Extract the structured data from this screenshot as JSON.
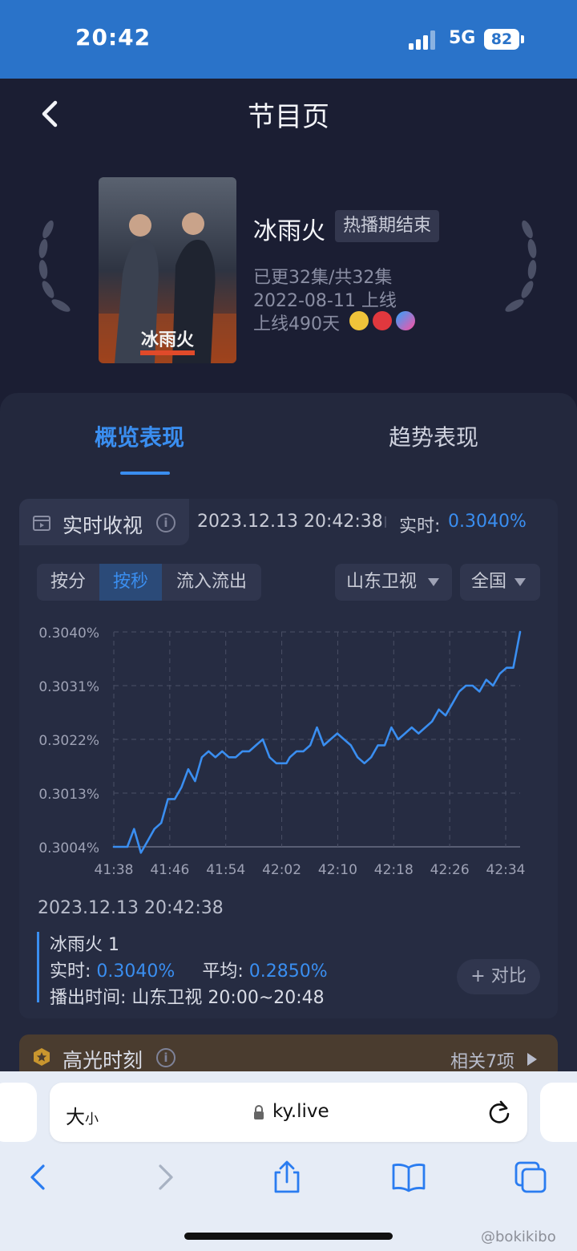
{
  "status_bar": {
    "time": "20:42",
    "network": "5G",
    "battery": "82"
  },
  "header": {
    "title": "节目页"
  },
  "show": {
    "title": "冰雨火",
    "status_chip": "热播期结束",
    "episodes": "已更32集/共32集",
    "premiere": "2022-08-11 上线",
    "days_online": "上线490天",
    "platforms": [
      "youku-icon",
      "cctv8-icon",
      "tencent-video-icon"
    ],
    "poster_title": "冰雨火"
  },
  "tabs": {
    "overview": "概览表现",
    "trend": "趋势表现"
  },
  "realtime": {
    "label": "实时收视",
    "info": "i",
    "timestamp": "2023.12.13 20:42:38",
    "rt_label": "实时:",
    "rt_value": "0.3040%"
  },
  "controls": {
    "granularity": [
      "按分",
      "按秒",
      "流入流出"
    ],
    "active_granularity": "按秒",
    "channel": "山东卫视",
    "region": "全国"
  },
  "chart_data": {
    "type": "line",
    "x_ticks": [
      "41:38",
      "41:46",
      "41:54",
      "42:02",
      "42:10",
      "42:18",
      "42:26",
      "42:34"
    ],
    "y_ticks": [
      "0.3040%",
      "0.3031%",
      "0.3022%",
      "0.3013%",
      "0.3004%"
    ],
    "ylim": [
      0.3004,
      0.304
    ],
    "grid": true,
    "color": "#3a8ef0",
    "series": [
      {
        "name": "冰雨火 1",
        "x": [
          0,
          2,
          3,
          3.5,
          4,
          5,
          6,
          7,
          8,
          9,
          10,
          11,
          12,
          13,
          14,
          15,
          16,
          17,
          18,
          19,
          20,
          21,
          22,
          23,
          24,
          25,
          25.5,
          26,
          27,
          28,
          29,
          30,
          31,
          32,
          33,
          34,
          35,
          36,
          37,
          38,
          39,
          40,
          41,
          42,
          43,
          44,
          45,
          46,
          47,
          48,
          49,
          50,
          51,
          52,
          53,
          54,
          55,
          56,
          57,
          58,
          59,
          60
        ],
        "values": [
          0.3004,
          0.3004,
          0.3007,
          0.3005,
          0.3003,
          0.3005,
          0.3007,
          0.3008,
          0.3012,
          0.3012,
          0.3014,
          0.3017,
          0.3015,
          0.3019,
          0.302,
          0.3019,
          0.302,
          0.3019,
          0.3019,
          0.302,
          0.302,
          0.3021,
          0.3022,
          0.3019,
          0.3018,
          0.3018,
          0.3018,
          0.3019,
          0.302,
          0.302,
          0.3021,
          0.3024,
          0.3021,
          0.3022,
          0.3023,
          0.3022,
          0.3021,
          0.3019,
          0.3018,
          0.3019,
          0.3021,
          0.3021,
          0.3024,
          0.3022,
          0.3023,
          0.3024,
          0.3023,
          0.3024,
          0.3025,
          0.3027,
          0.3026,
          0.3028,
          0.303,
          0.3031,
          0.3031,
          0.303,
          0.3032,
          0.3031,
          0.3033,
          0.3034,
          0.3034,
          0.304
        ]
      }
    ]
  },
  "selection": {
    "timestamp": "2023.12.13 20:42:38",
    "series_name": "冰雨火 1",
    "realtime_label": "实时:",
    "realtime_value": "0.3040%",
    "avg_label": "平均:",
    "avg_value": "0.2850%",
    "airtime_label": "播出时间:",
    "airtime_value": "山东卫视 20:00~20:48",
    "compare": "+ 对比"
  },
  "highlights": {
    "label": "高光时刻",
    "related": "相关7项"
  },
  "browser": {
    "aa_big": "大",
    "aa_small": "小",
    "url": "ky.live"
  },
  "watermark": "@bokikibo",
  "colors": {
    "accent": "#3a8ef0",
    "status_bar": "#2a73c9",
    "background": "#1b1e33"
  }
}
